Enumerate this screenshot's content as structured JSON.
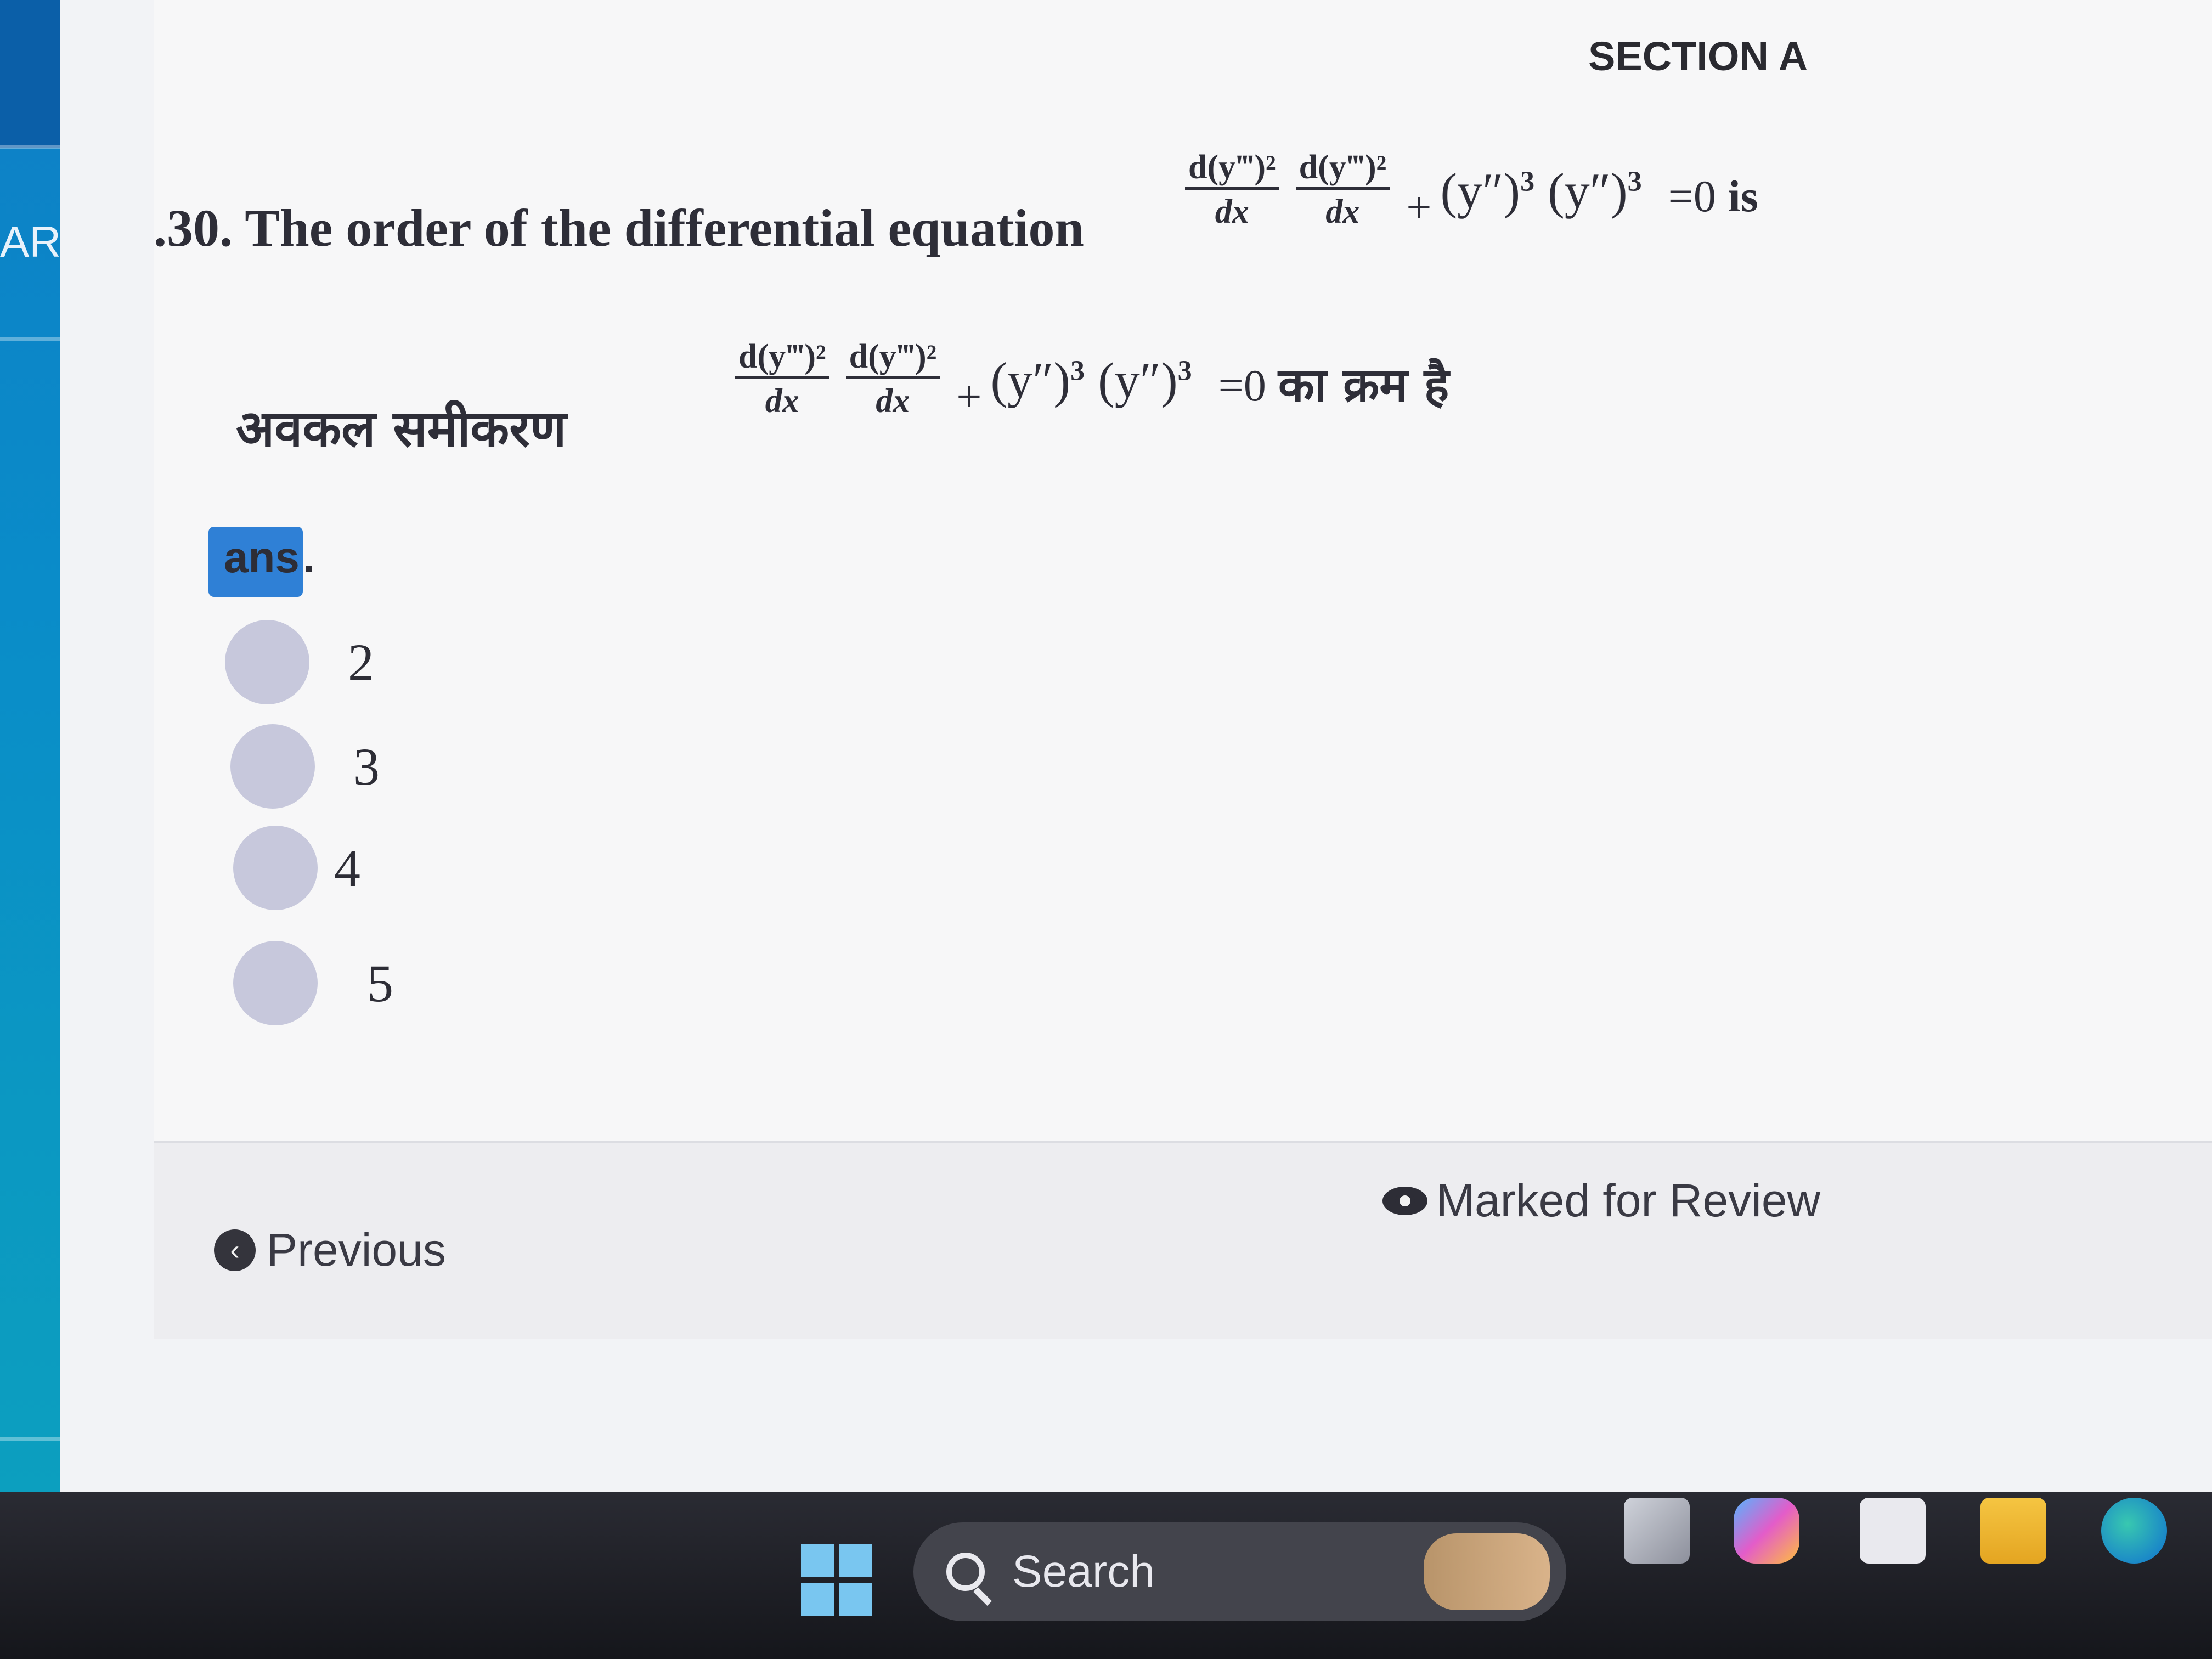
{
  "sidebar": {
    "label": "AR"
  },
  "section": {
    "title": "SECTION A"
  },
  "question": {
    "number_text": ".30. The order of the differential equation",
    "hindi_prefix": "अवकल समीकरण",
    "equation": {
      "frac1_num": "d(y‴)²",
      "frac1_den": "dx",
      "frac2_num": "d(y‴)²",
      "frac2_den": "dx",
      "plus": "+",
      "term1": "(y″)",
      "term1_exp": "3",
      "term2": "(y″)",
      "term2_exp": "3",
      "equals": "=0"
    },
    "english_suffix": "is",
    "hindi_suffix": "का क्रम है"
  },
  "answer": {
    "label_highlight": "ans",
    "label_rest": ".",
    "options": [
      "2",
      "3",
      "4",
      "5"
    ]
  },
  "footer": {
    "previous_label": "Previous",
    "marked_label": "Marked for Review"
  },
  "taskbar": {
    "search_label": "Search"
  }
}
